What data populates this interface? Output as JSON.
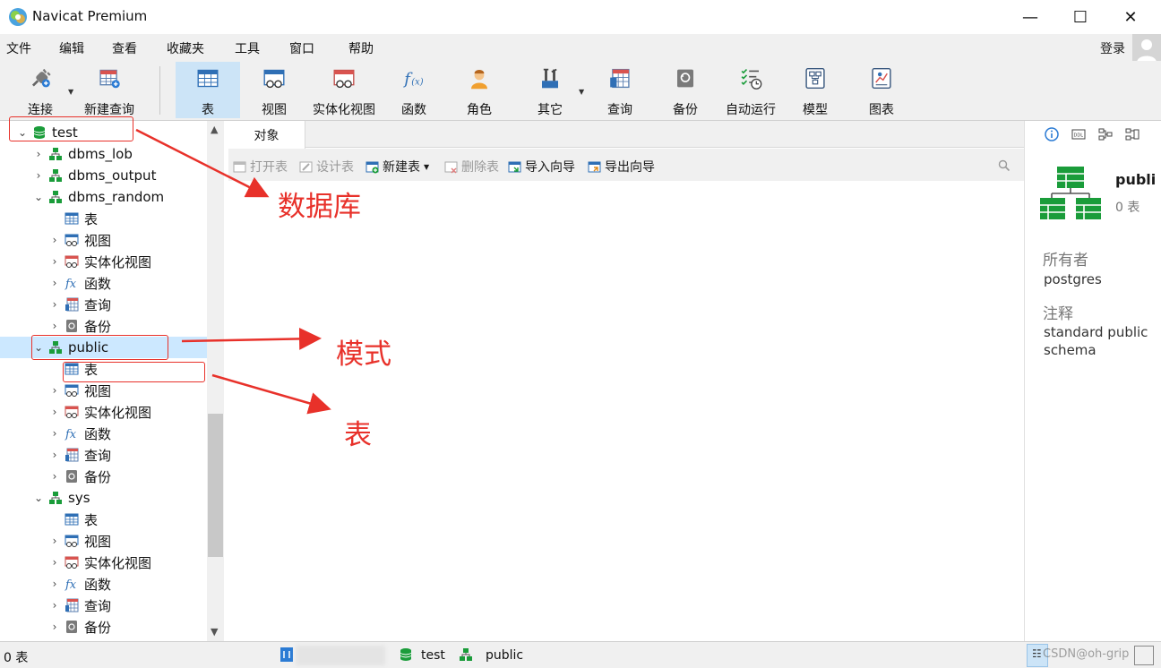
{
  "app": {
    "title": "Navicat Premium"
  },
  "window": {
    "minimize": "—",
    "maximize": "☐",
    "close": "✕"
  },
  "menu": [
    "文件",
    "编辑",
    "查看",
    "收藏夹",
    "工具",
    "窗口",
    "帮助"
  ],
  "login": "登录",
  "toolbar": {
    "connect": "连接",
    "new_query": "新建查询",
    "table": "表",
    "view": "视图",
    "mview": "实体化视图",
    "function": "函数",
    "role": "角色",
    "other": "其它",
    "query": "查询",
    "backup": "备份",
    "autorun": "自动运行",
    "model": "模型",
    "chart": "图表",
    "active": "表"
  },
  "tree": {
    "db": "test",
    "schemas": [
      "dbms_lob",
      "dbms_output",
      "dbms_random",
      "public",
      "sys"
    ],
    "children": [
      "表",
      "视图",
      "实体化视图",
      "函数",
      "查询",
      "备份"
    ],
    "selected": "public"
  },
  "tabs": {
    "objects": "对象"
  },
  "subtoolbar": {
    "open": "打开表",
    "design": "设计表",
    "new": "新建表",
    "delete": "删除表",
    "import": "导入向导",
    "export": "导出向导"
  },
  "rpanel": {
    "name": "publi",
    "count": "0 表",
    "owner_label": "所有者",
    "owner": "postgres",
    "comment_label": "注释",
    "comment": "standard public schema"
  },
  "status": {
    "count": "0 表",
    "db": "test",
    "schema": "public",
    "watermark": "CSDN@oh-grip"
  },
  "annotations": {
    "database": "数据库",
    "schema": "模式",
    "table": "表"
  },
  "colors": {
    "accent": "#cce4f7",
    "annotation": "#e8312a",
    "db_green": "#1a9c3a"
  }
}
